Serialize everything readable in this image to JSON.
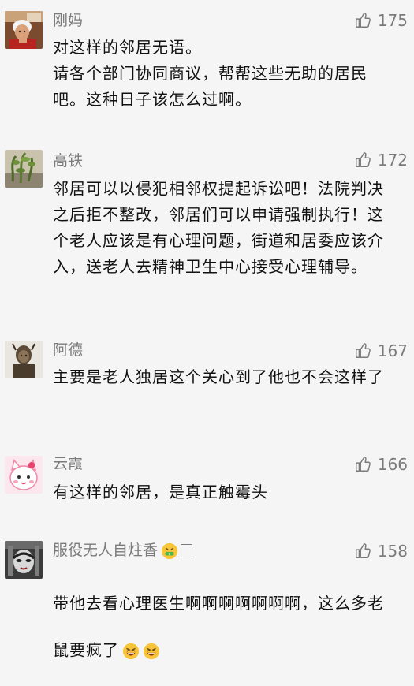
{
  "comments": [
    {
      "username": "刚妈",
      "likes": "175",
      "text": "对这样的邻居无语。\n请各个部门协同商议，帮帮这些无助的居民吧。这种日子该怎么过啊。",
      "avatar_icon": "elderly-woman-avatar"
    },
    {
      "username": "高铁",
      "likes": "172",
      "text": "邻居可以以侵犯相邻权提起诉讼吧！法院判决之后拒不整改，邻居们可以申请强制执行！这个老人应该是有心理问题，街道和居委应该介入，送老人去精神卫生中心接受心理辅导。",
      "avatar_icon": "plant-avatar"
    },
    {
      "username": "阿德",
      "likes": "167",
      "text": "主要是老人独居这个关心到了他也不会这样了",
      "avatar_icon": "statue-avatar"
    },
    {
      "username": "云霞",
      "likes": "166",
      "text": "有这样的邻居，是真正触霉头",
      "avatar_icon": "cartoon-cat-avatar"
    },
    {
      "username": "服役无人自炷香",
      "likes": "158",
      "text": "带他去看心理医生啊啊啊啊啊啊啊，这么多老鼠要疯了",
      "avatar_icon": "opera-mask-avatar",
      "username_suffix_emoji": "money-mouth-face",
      "username_suffix_glyph": "□",
      "text_suffix_emojis": [
        "grinning-squinting-face",
        "grinning-squinting-face"
      ]
    }
  ],
  "colors": {
    "background": "#f5f5f5",
    "username": "#7b7b7b",
    "text": "#111111",
    "like": "#7b7b7b"
  }
}
